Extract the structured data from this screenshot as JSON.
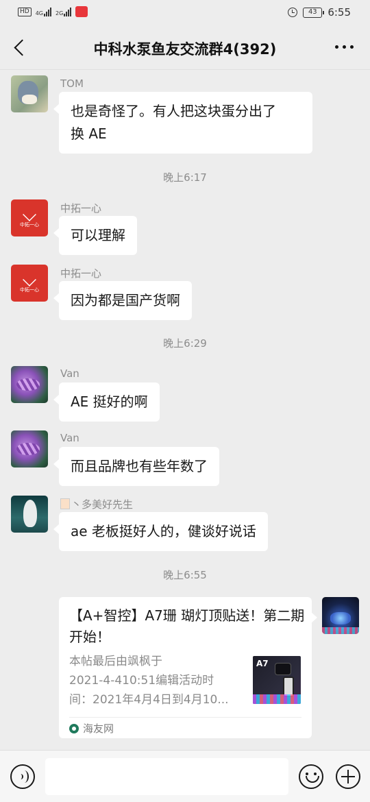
{
  "status_bar": {
    "hd": "HD",
    "sig1": "4G",
    "sig2": "2G",
    "battery": "43",
    "time": "6:55"
  },
  "header": {
    "title": "中科水泵鱼友交流群4(392)"
  },
  "messages": [
    {
      "sender": "TOM",
      "text": "也是奇怪了。有人把这块蛋分出了\n换 AE"
    },
    {
      "time": "晚上6:17"
    },
    {
      "sender": "中拓一心",
      "text": "可以理解",
      "avatar_text": "中拓一心"
    },
    {
      "sender": "中拓一心",
      "text": "因为都是国产货啊",
      "avatar_text": "中拓一心"
    },
    {
      "time": "晚上6:29"
    },
    {
      "sender": "Van",
      "text": "AE 挺好的啊"
    },
    {
      "sender": "Van",
      "text": "而且品牌也有些年数了"
    },
    {
      "sender": "丶多美好先生",
      "text": "ae 老板挺好人的，健谈好说话"
    },
    {
      "time": "晚上6:55"
    }
  ],
  "card": {
    "title": "【A+智控】A7珊 瑚灯顶贴送！第二期开始！",
    "description": "本帖最后由飒枫于\n2021-4-410:51编辑活动时\n间：2021年4月4日到4月10...",
    "thumb_label": "A7",
    "source": "海友网"
  },
  "colors": {
    "background": "#ededed",
    "bubble": "#ffffff",
    "meta_text": "#8c8c8c"
  }
}
